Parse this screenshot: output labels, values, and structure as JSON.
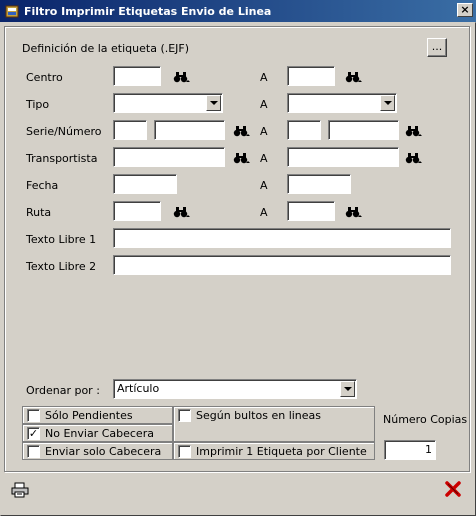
{
  "window": {
    "title": "Filtro Imprimir Etiquetas Envio de Linea",
    "close_glyph": "×"
  },
  "definicion": {
    "label": "Definición de la etiqueta (.EJF)",
    "browse_label": "..."
  },
  "filters": {
    "range_separator": "A",
    "centro": {
      "label": "Centro",
      "from": "",
      "to": ""
    },
    "tipo": {
      "label": "Tipo",
      "from": "",
      "to": ""
    },
    "serie_numero": {
      "label": "Serie/Número",
      "serie_from": "",
      "numero_from": "",
      "serie_to": "",
      "numero_to": ""
    },
    "transportista": {
      "label": "Transportista",
      "from": "",
      "to": ""
    },
    "fecha": {
      "label": "Fecha",
      "from": "",
      "to": ""
    },
    "ruta": {
      "label": "Ruta",
      "from": "",
      "to": ""
    }
  },
  "texto_libre_1": {
    "label": "Texto Libre 1",
    "value": ""
  },
  "texto_libre_2": {
    "label": "Texto Libre 2",
    "value": ""
  },
  "ordenar": {
    "label": "Ordenar por :",
    "value": "Artículo"
  },
  "options": {
    "solo_pendientes": {
      "label": "Sólo Pendientes",
      "checked": false
    },
    "no_enviar_cabecera": {
      "label": "No Enviar Cabecera",
      "checked": true
    },
    "enviar_solo_cabecera": {
      "label": "Enviar solo Cabecera",
      "checked": false
    },
    "segun_bultos": {
      "label": "Según bultos en lineas",
      "checked": false
    },
    "imprimir_por_cliente": {
      "label": "Imprimir 1 Etiqueta por Cliente",
      "checked": false
    }
  },
  "copias": {
    "label": "Número Copias",
    "value": "1"
  },
  "icons": {
    "app": "app-icon",
    "search": "binoculars-icon",
    "print": "printer-icon",
    "cancel": "red-x-icon"
  },
  "colors": {
    "titlebar_start": "#0a246a",
    "titlebar_end": "#3a6ea5",
    "cancel_red": "#cc0000",
    "face": "#d4d0c8"
  }
}
